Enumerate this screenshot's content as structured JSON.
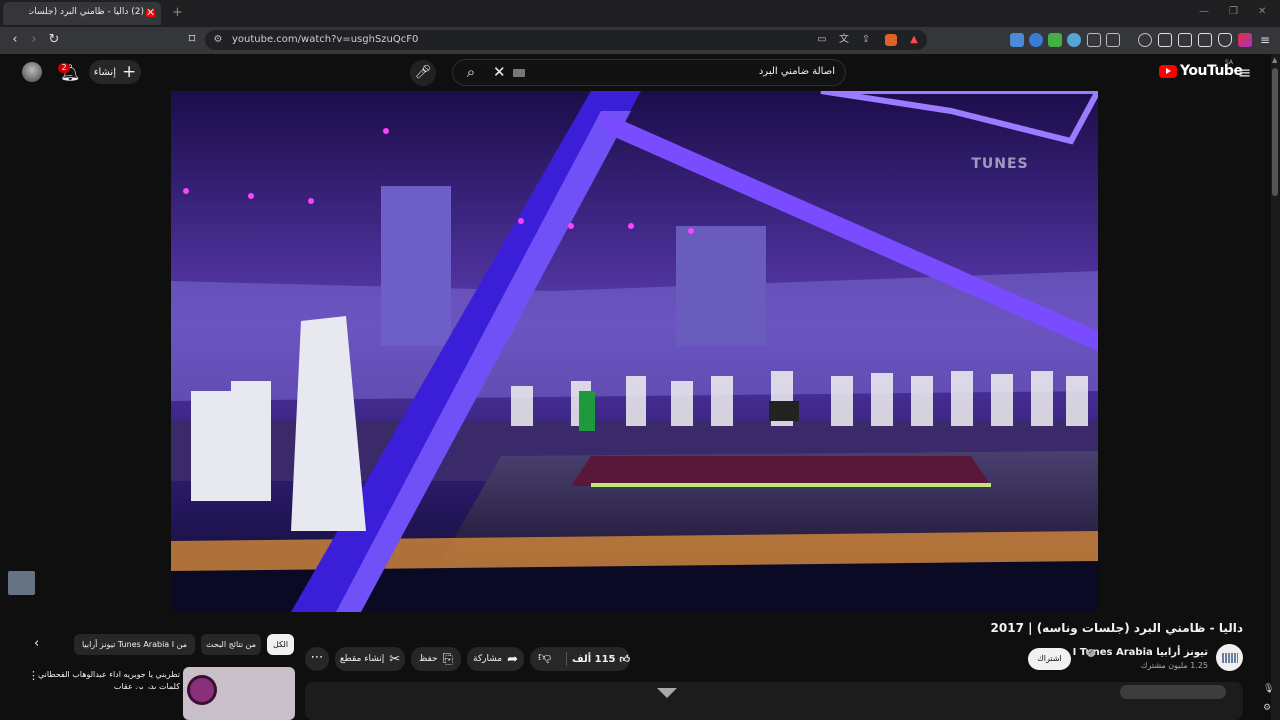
{
  "browser": {
    "tab_title": "(2) داليا - ظامني البرد (جلسات ونّاسه) | 2017 - YouTube",
    "tab_close": "✕",
    "new_tab": "+",
    "url": "youtube.com/watch?v=usghSzuQcF0",
    "window_controls": {
      "minimize": "—",
      "restore": "❐",
      "close": "✕"
    }
  },
  "youtube": {
    "logo_text": "YouTube",
    "country_code": "SA",
    "search_query": "اصالة ضامني البرد",
    "create_label": "إنشاء",
    "notifications_count": "2"
  },
  "video": {
    "title": "داليا - ظامني البرد (جلسات وناسه) | 2017",
    "watermark": "TUNES",
    "channel_name": "تيونز أرابيا I Tunes Arabia",
    "subscribers": "1.25 مليون مشترك",
    "subscribe_label": "اشتراك",
    "likes": "115 ألف",
    "share_label": "مشاركة",
    "save_label": "حفظ",
    "clip_label": "إنشاء مقطع"
  },
  "chips": [
    {
      "label": "الكل",
      "active": true
    },
    {
      "label": "من نتائج البحث",
      "active": false
    },
    {
      "label": "من Tunes Arabia I تيونز أرابيا",
      "active": false
    }
  ],
  "recommendation": {
    "title": "تطربني يا جويريه اداء عبدالوهاب الفحطاني كلمات بدر بن عقاب"
  },
  "colors": {
    "accent_red": "#ff0000",
    "background": "#0f0f0f",
    "surface": "#272727"
  }
}
